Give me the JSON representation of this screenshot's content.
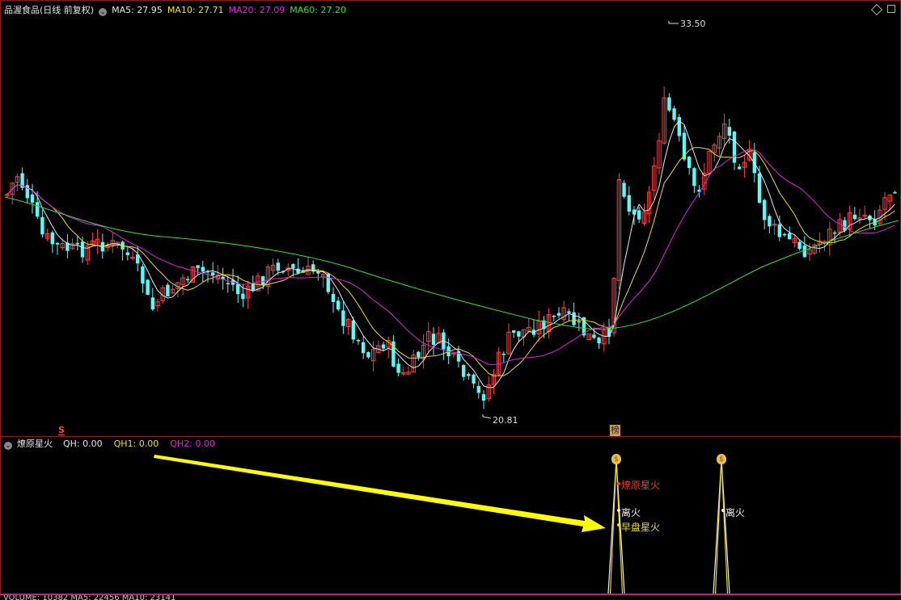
{
  "main": {
    "title": "品渥食品(日线 前复权)",
    "ma_labels": [
      {
        "text": "MA5: 27.95",
        "color": "#e8e8e8"
      },
      {
        "text": "MA10: 27.71",
        "color": "#f0e000"
      },
      {
        "text": "MA20: 27.09",
        "color": "#e020e0"
      },
      {
        "text": "MA60: 27.20",
        "color": "#30e030"
      }
    ],
    "high_label": "33.50",
    "low_label": "20.81",
    "s_marker": "S",
    "rank_marker": "榜",
    "colors": {
      "up": "#ff4040",
      "down": "#54fcfc",
      "ma5": "#e8e8e8",
      "ma10": "#f0e000",
      "ma20": "#e020e0",
      "ma60": "#30e030"
    }
  },
  "indicator": {
    "title": "燎原星火",
    "values": [
      {
        "text": "QH: 0.00",
        "color": "#e8e8e8"
      },
      {
        "text": "QH1: 0.00",
        "color": "#f0e000"
      },
      {
        "text": "QH2: 0.00",
        "color": "#e020e0"
      }
    ],
    "signal1": {
      "label_red": "燎原星火",
      "label_white": "离火",
      "label_yellow": "早盘星火"
    },
    "signal2": {
      "label_white": "离火"
    },
    "money_icon": "$"
  },
  "volume": {
    "title": "VOLUME: 10382 MA5: 22456 MA10: 23141"
  }
}
